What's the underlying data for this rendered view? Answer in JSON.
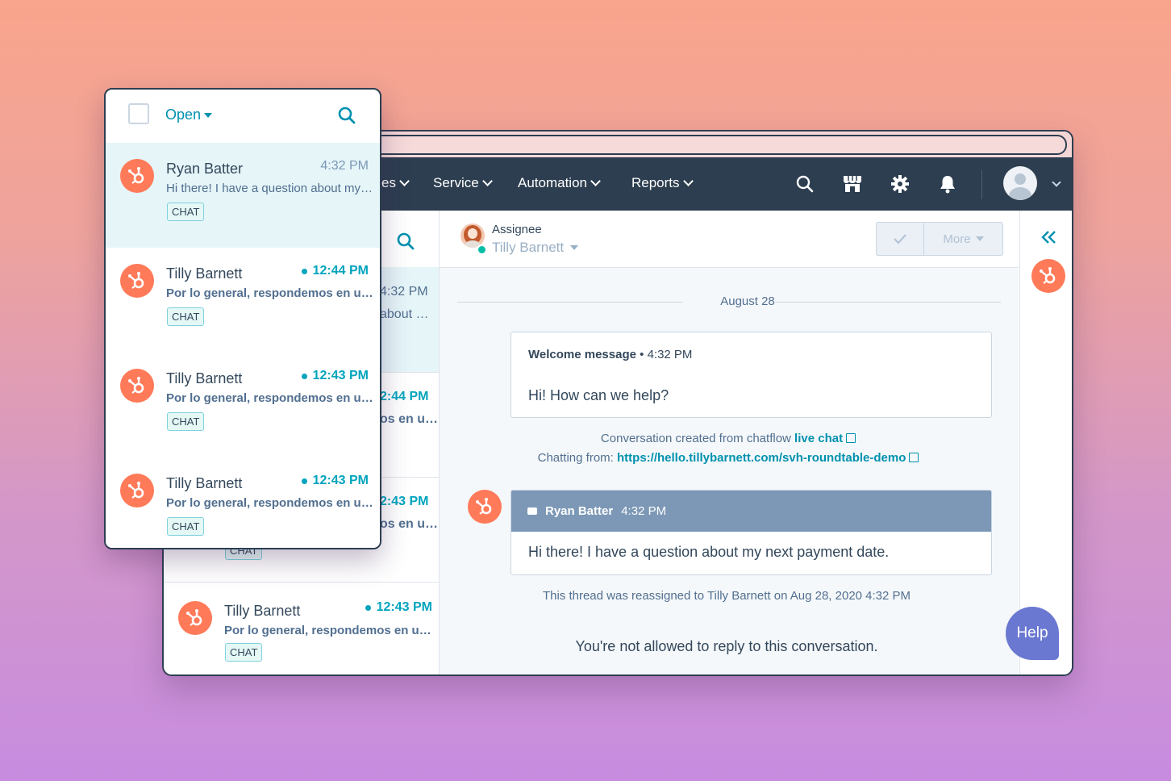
{
  "navbar": {
    "items": [
      {
        "label": "es"
      },
      {
        "label": "Service"
      },
      {
        "label": "Automation"
      },
      {
        "label": "Reports"
      }
    ],
    "icons": [
      "search-icon",
      "marketplace-icon",
      "settings-gear-icon",
      "notifications-bell-icon"
    ],
    "background": "#2d3e50"
  },
  "filter": {
    "status_label": "Open"
  },
  "inbox_rows": [
    {
      "name": "Ryan Batter",
      "time": "4:32 PM",
      "preview": "Hi there! I have a question about my next payment date.",
      "tag": "CHAT",
      "unread": false,
      "selected": true
    },
    {
      "name": "Tilly Barnett",
      "time": "12:44 PM",
      "preview": "Por lo general, respondemos en unas horas",
      "tag": "CHAT",
      "unread": true,
      "selected": false
    },
    {
      "name": "Tilly Barnett",
      "time": "12:43 PM",
      "preview": "Por lo general, respondemos en unas horas",
      "tag": "CHAT",
      "unread": true,
      "selected": false
    },
    {
      "name": "Tilly Barnett",
      "time": "12:43 PM",
      "preview": "Por lo general, respondemos en unas horas",
      "tag": "CHAT",
      "unread": true,
      "selected": false
    }
  ],
  "back_list": {
    "fragments": {
      "time1": "4:32 PM",
      "about1": "about …",
      "time2": "2:44 PM",
      "snip2": "os en u…",
      "time3": "2:43 PM",
      "snip3": "os en u…",
      "tag3": "CHAT"
    },
    "last_row": {
      "name": "Tilly Barnett",
      "time": "12:43 PM",
      "preview": "Por lo general, respondemos en u…",
      "tag": "CHAT"
    }
  },
  "conversation": {
    "assignee_label": "Assignee",
    "assignee_name": "Tilly Barnett",
    "more_label": "More",
    "date_separator": "August 28",
    "welcome": {
      "title": "Welcome message",
      "time": "4:32 PM",
      "text": "Hi! How can we help?"
    },
    "created_prefix": "Conversation created from chatflow",
    "created_link": "live chat",
    "chatting_prefix": "Chatting from:",
    "chatting_link": "https://hello.tillybarnett.com/svh-roundtable-demo",
    "message": {
      "sender": "Ryan Batter",
      "time": "4:32 PM",
      "text": "Hi there! I have a question about my next payment date."
    },
    "reassigned_note": "This thread was reassigned to Tilly Barnett on Aug 28, 2020 4:32 PM",
    "no_reply_note": "You're not allowed to reply to this conversation."
  },
  "help_label": "Help",
  "colors": {
    "brand_orange": "#ff7a59",
    "teal": "#00a4bd",
    "link": "#0091ae",
    "help": "#6a78d1"
  }
}
